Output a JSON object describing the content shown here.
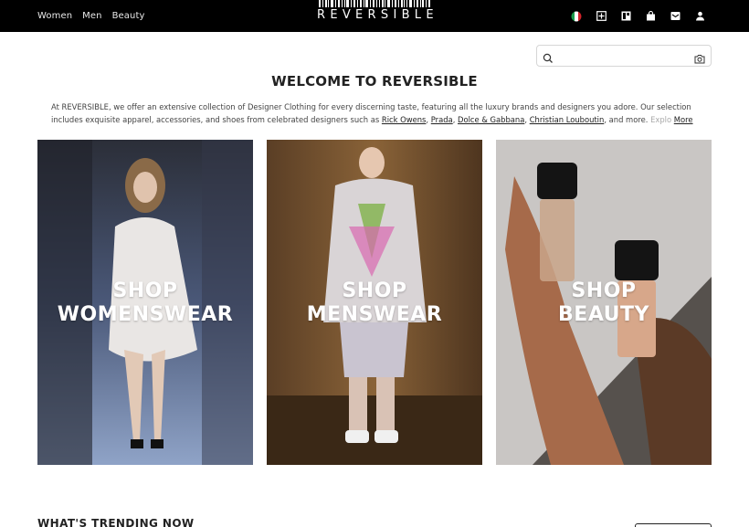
{
  "header": {
    "nav": [
      "Women",
      "Men",
      "Beauty"
    ],
    "logo": "REVERSIBLE",
    "icons": [
      "italy-flag-icon",
      "gift-icon",
      "wishlist-icon",
      "bag-icon",
      "inbox-icon",
      "account-icon"
    ]
  },
  "search": {
    "placeholder": ""
  },
  "welcome": {
    "title": "WELCOME TO REVERSIBLE",
    "text_before": "At REVERSIBLE, we offer an extensive collection of Designer Clothing for every discerning taste, featuring all the luxury brands and designers you adore. Our selection includes exquisite apparel, accessories, and shoes from celebrated designers such as ",
    "brands": [
      "Rick Owens",
      "Prada",
      "Dolce & Gabbana",
      "Christian Louboutin"
    ],
    "text_after": ", and more. ",
    "text_fade": "Explo",
    "more": "More"
  },
  "tiles": [
    {
      "line1": "SHOP",
      "line2": "WOMENSWEAR"
    },
    {
      "line1": "SHOP",
      "line2": "MENSWEAR"
    },
    {
      "line1": "SHOP",
      "line2": "BEAUTY"
    }
  ],
  "trending": {
    "title": "WHAT'S TRENDING NOW"
  },
  "colors": {
    "topbar": "#000000",
    "text": "#222222"
  }
}
